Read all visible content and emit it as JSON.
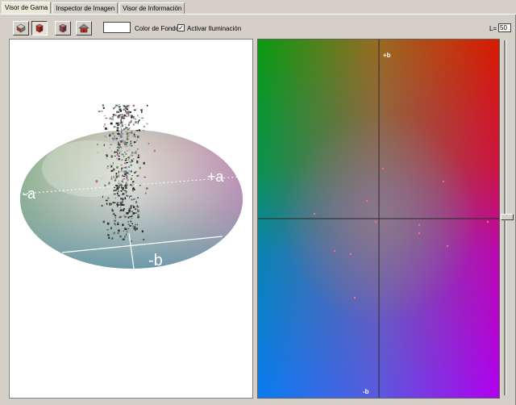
{
  "tabs": [
    {
      "label": "Visor de Gama",
      "active": true
    },
    {
      "label": "Inspector de Imagen",
      "active": false
    },
    {
      "label": "Visor de Información",
      "active": false
    }
  ],
  "toolbar": {
    "buttons": [
      {
        "icon": "cube-rotate-icon",
        "pressed": false
      },
      {
        "icon": "cube-red-icon",
        "pressed": true
      },
      {
        "icon": "cube-shaded-icon",
        "pressed": false
      },
      {
        "icon": "house-icon",
        "pressed": false
      }
    ],
    "background_color_label": "Color de Fondo",
    "background_color_value": "#ffffff",
    "lighting_label": "Activar Iluminación",
    "lighting_checked": true,
    "lightness_label": "L=",
    "lightness_value": "50"
  },
  "view3d": {
    "axis_labels": {
      "neg_a": "-a",
      "pos_a": "+a",
      "neg_b": "-b"
    }
  },
  "plane": {
    "axis_labels": {
      "pos_b": "+b",
      "neg_b": "-b"
    },
    "colors": {
      "green": "#0a9a10",
      "red": "#d81a00",
      "blue": "#0a7cf0",
      "magenta": "#b000f0"
    }
  },
  "slider": {
    "value_fraction": 0.5
  }
}
